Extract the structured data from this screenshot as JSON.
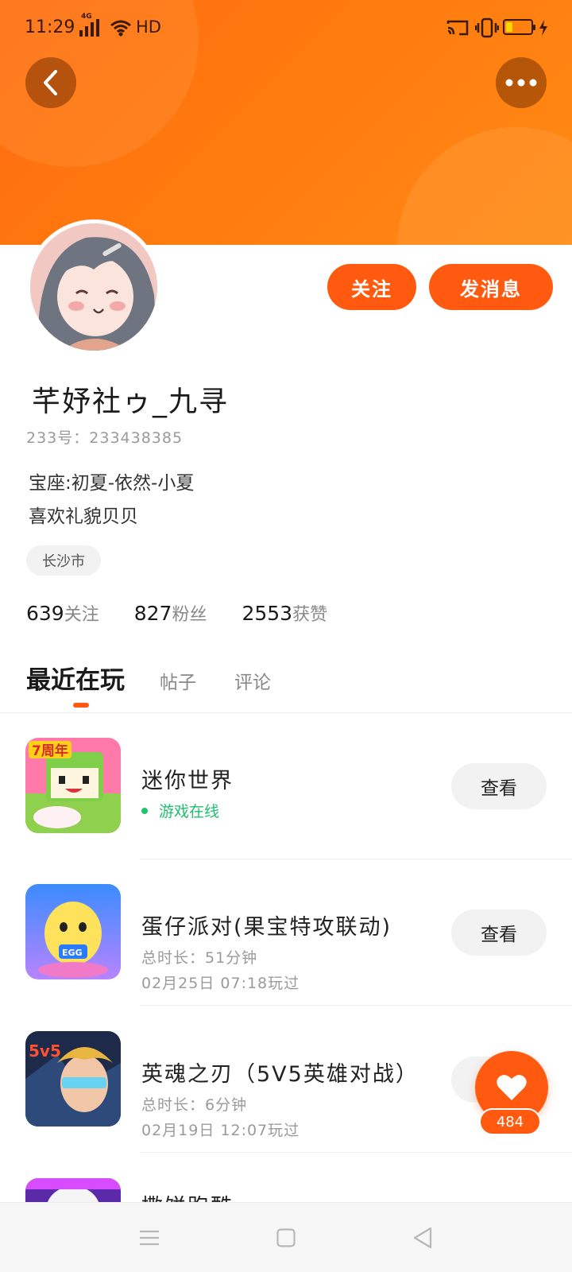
{
  "status_bar": {
    "time": "11:29",
    "network": "4G",
    "hd": "HD"
  },
  "profile": {
    "username": "芊妤社ゥ_九寻",
    "id_label": "233号：233438385",
    "bio_line1": "宝座:初夏-依然-小夏",
    "bio_line2": "喜欢礼貌贝贝",
    "location": "长沙市",
    "follow_button": "关注",
    "message_button": "发消息"
  },
  "stats": [
    {
      "value": "639",
      "label": "关注"
    },
    {
      "value": "827",
      "label": "粉丝"
    },
    {
      "value": "2553",
      "label": "获赞"
    }
  ],
  "tabs": [
    {
      "label": "最近在玩",
      "active": true
    },
    {
      "label": "帖子",
      "active": false
    },
    {
      "label": "评论",
      "active": false
    }
  ],
  "games": [
    {
      "name": "迷你世界",
      "status": "游戏在线",
      "action": "查看"
    },
    {
      "name": "蛋仔派对(果宝特攻联动)",
      "duration": "总时长：51分钟",
      "last_played": "02月25日 07:18玩过",
      "action": "查看"
    },
    {
      "name": "英魂之刃（5V5英雄对战）",
      "duration": "总时长：6分钟",
      "last_played": "02月19日 12:07玩过",
      "action": "查看"
    },
    {
      "name": "撒饼跑酷"
    }
  ],
  "like": {
    "count": "484"
  },
  "colors": {
    "accent": "#ff5a10",
    "header": "#ff7a0f",
    "online": "#1fc46f"
  },
  "icons": [
    "back-arrow-icon",
    "more-dots-icon",
    "heart-icon",
    "menu-icon",
    "home-square-icon",
    "back-triangle-icon"
  ]
}
